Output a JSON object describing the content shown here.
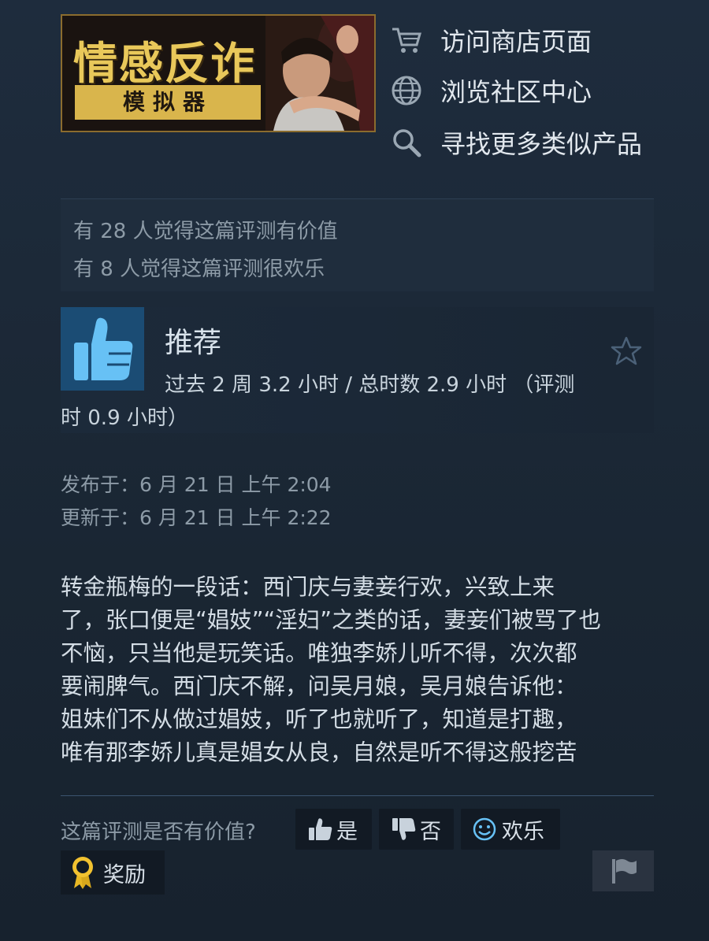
{
  "game": {
    "banner_title": "情感反诈",
    "banner_subtitle": "模拟器"
  },
  "links": [
    {
      "icon": "cart-icon",
      "label": "访问商店页面"
    },
    {
      "icon": "globe-icon",
      "label": "浏览社区中心"
    },
    {
      "icon": "search-icon",
      "label": "寻找更多类似产品"
    }
  ],
  "helpful": {
    "valuable": "有 28 人觉得这篇评测有价值",
    "funny": "有 8 人觉得这篇评测很欢乐"
  },
  "recommendation": {
    "label": "推荐",
    "hours_line1": "过去 2 周 3.2 小时 / 总时数 2.9 小时 （评测",
    "hours_line2": "时 0.9 小时）"
  },
  "dates": {
    "posted": "发布于：6 月 21 日 上午 2:04",
    "updated": "更新于：6 月 21 日 上午 2:22"
  },
  "review": {
    "text": "转金瓶梅的一段话：西门庆与妻妾行欢，兴致上来\n了，张口便是“娼妓”“淫妇”之类的话，妻妾们被骂了也\n不恼，只当他是玩笑话。唯独李娇儿听不得，次次都\n要闹脾气。西门庆不解，问吴月娘，吴月娘告诉他：\n姐妹们不从做过娼妓，听了也就听了，知道是打趣，\n唯有那李娇儿真是娼女从良，自然是听不得这般挖苦"
  },
  "vote": {
    "question": "这篇评测是否有价值?",
    "yes": "是",
    "no": "否",
    "funny": "欢乐",
    "award": "奖励"
  },
  "colors": {
    "background": "#1b2838",
    "accent_blue": "#67c1f5",
    "thumb_tile": "#1b4c74",
    "banner_gold": "#e9c85a"
  }
}
